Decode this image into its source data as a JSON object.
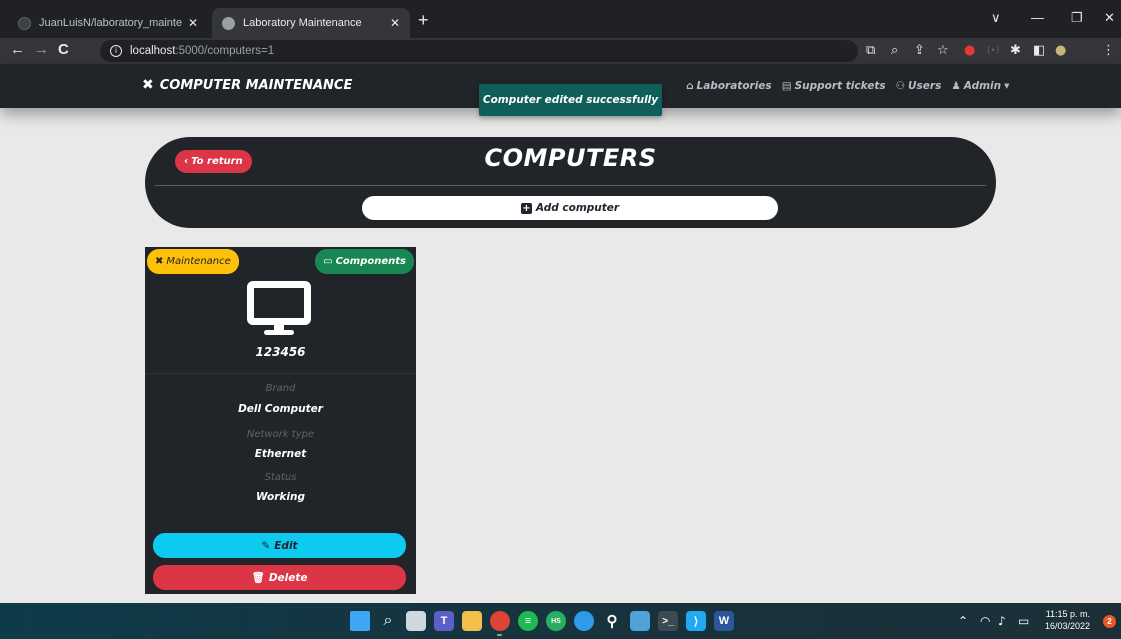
{
  "browser": {
    "tabs": [
      {
        "title": "JuanLuisN/laboratory_maintenan",
        "active": false
      },
      {
        "title": "Laboratory Maintenance",
        "active": true
      }
    ],
    "new_tab_label": "+",
    "url_host": "localhost",
    "url_rest": ":5000/computers=1",
    "nav": {
      "back": "←",
      "forward": "→",
      "reload": "C"
    },
    "window_controls": {
      "chevron": "∨",
      "minimize": "—",
      "restore": "❐",
      "close": "✕"
    }
  },
  "app": {
    "brand": "COMPUTER MAINTENANCE",
    "nav_links": {
      "laboratories": "Laboratories",
      "support_tickets": "Support tickets",
      "users": "Users",
      "admin": "Admin"
    },
    "toast": "Computer edited successfully",
    "page_title": "COMPUTERS",
    "return_label": "To return",
    "add_label": "Add computer"
  },
  "computer": {
    "maintenance_label": "Maintenance",
    "components_label": "Components",
    "id": "123456",
    "brand_label": "Brand",
    "brand_value": "Dell Computer",
    "network_label": "Network type",
    "network_value": "Ethernet",
    "status_label": "Status",
    "status_value": "Working",
    "edit_label": "Edit",
    "delete_label": "Delete"
  },
  "taskbar": {
    "time": "11:15 p. m.",
    "date": "16/03/2022",
    "notifications": "2"
  },
  "colors": {
    "navbar": "#212529",
    "danger": "#dc3545",
    "warning": "#ffc107",
    "success": "#198754",
    "info": "#0dcaf0",
    "toast": "#0f5e5a"
  }
}
